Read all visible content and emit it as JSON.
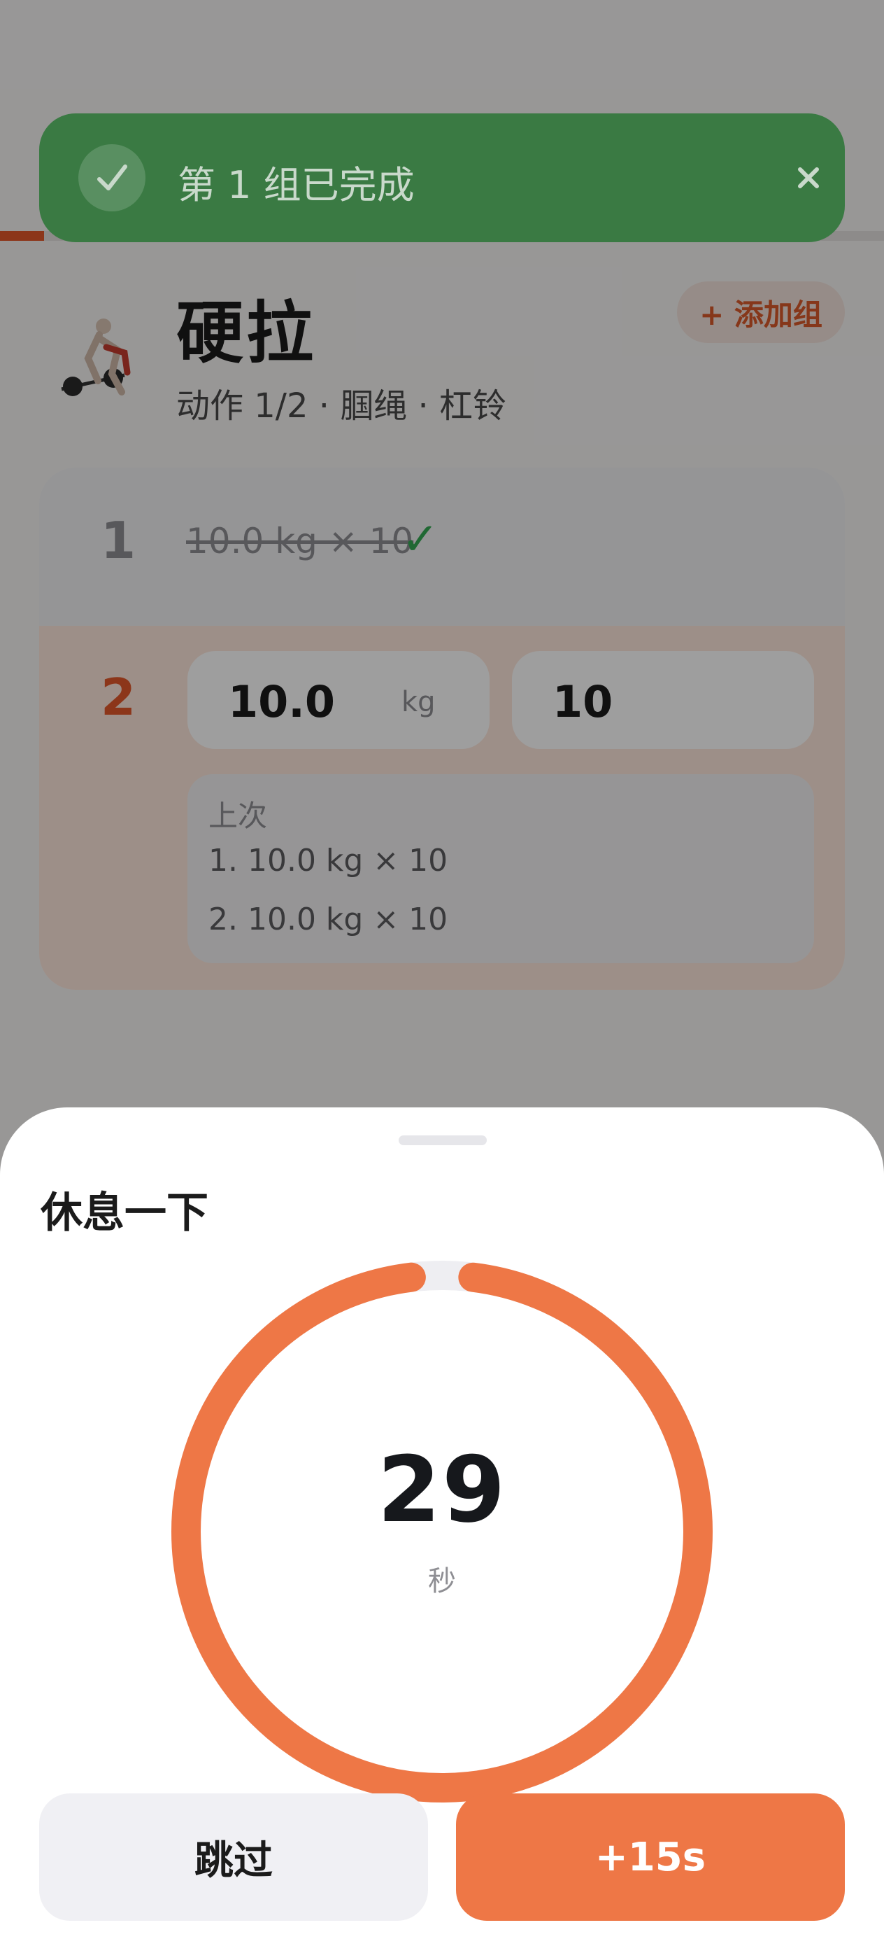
{
  "workout": {
    "progress_fraction": 0.05,
    "exercise": {
      "name": "硬拉",
      "meta": "动作 1/2 · 腘绳 · 杠铃",
      "add_set_label": "+ 添加组",
      "thumbnail_icon": "deadlift-figure"
    },
    "sets": [
      {
        "number": "1",
        "summary": "10.0 kg × 10",
        "done_mark": "✓"
      },
      {
        "number": "2",
        "weight": "10.0",
        "unit": "kg",
        "reps": "10",
        "last_time": {
          "label": "上次",
          "lines": [
            "1. 10.0 kg × 10",
            "2. 10.0 kg × 10"
          ]
        }
      }
    ]
  },
  "toast": {
    "message": "第 1 组已完成",
    "icon": "check-icon",
    "close_icon": "close-icon"
  },
  "rest_sheet": {
    "title": "休息一下",
    "seconds": "29",
    "unit": "秒",
    "remaining_fraction": 0.97,
    "skip_label": "跳过",
    "add_time_label": "+15s"
  },
  "colors": {
    "accent": "#ee7746",
    "toast_green": "#3a7a43",
    "done_green": "#34a853"
  }
}
